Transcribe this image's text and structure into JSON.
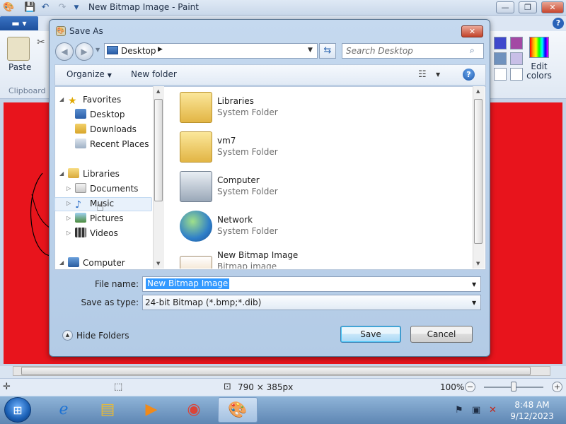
{
  "paint": {
    "title": "New Bitmap Image - Paint",
    "ribbon": {
      "paste_label": "Paste",
      "clipboard_group": "Clipboard",
      "edit_colors_label": "Edit colors",
      "swatches": [
        "#3f48cc",
        "#a349a4",
        "#7092be",
        "#c8bfe7",
        "#ffffff",
        "#ffffff"
      ]
    },
    "canvas_color": "#e8141c",
    "status": {
      "dimensions": "790 × 385px",
      "zoom": "100%",
      "zoom_level_fraction": 0.5
    }
  },
  "dialog": {
    "title": "Save As",
    "address": {
      "location": "Desktop"
    },
    "search": {
      "placeholder": "Search Desktop"
    },
    "commands": {
      "organize": "Organize",
      "new_folder": "New folder"
    },
    "nav_tree": {
      "items": [
        {
          "label": "Favorites",
          "icon": "star-icon"
        },
        {
          "label": "Desktop",
          "icon": "desktop-icon"
        },
        {
          "label": "Downloads",
          "icon": "downloads-icon"
        },
        {
          "label": "Recent Places",
          "icon": "recent-places-icon"
        },
        {
          "label": "Libraries",
          "icon": "libraries-icon"
        },
        {
          "label": "Documents",
          "icon": "documents-icon"
        },
        {
          "label": "Music",
          "icon": "music-icon"
        },
        {
          "label": "Pictures",
          "icon": "pictures-icon"
        },
        {
          "label": "Videos",
          "icon": "videos-icon"
        },
        {
          "label": "Computer",
          "icon": "computer-icon"
        }
      ]
    },
    "files": [
      {
        "name": "Libraries",
        "type": "System Folder",
        "icon": "libraries-folder-icon"
      },
      {
        "name": "vm7",
        "type": "System Folder",
        "icon": "user-folder-icon"
      },
      {
        "name": "Computer",
        "type": "System Folder",
        "icon": "computer-icon"
      },
      {
        "name": "Network",
        "type": "System Folder",
        "icon": "network-icon"
      },
      {
        "name": "New Bitmap Image",
        "type": "Bitmap image",
        "icon": "bitmap-icon"
      }
    ],
    "form": {
      "file_name_label": "File name:",
      "file_name_value": "New Bitmap Image",
      "save_type_label": "Save as type:",
      "save_type_value": "24-bit Bitmap (*.bmp;*.dib)"
    },
    "hide_folders": "Hide Folders",
    "save_button": "Save",
    "cancel_button": "Cancel"
  },
  "taskbar": {
    "items": [
      {
        "icon": "internet-explorer-icon"
      },
      {
        "icon": "file-explorer-icon"
      },
      {
        "icon": "media-player-icon"
      },
      {
        "icon": "chrome-icon"
      },
      {
        "icon": "paint-icon",
        "active": true
      }
    ],
    "clock_time": "8:48 AM",
    "clock_date": "9/12/2023"
  }
}
